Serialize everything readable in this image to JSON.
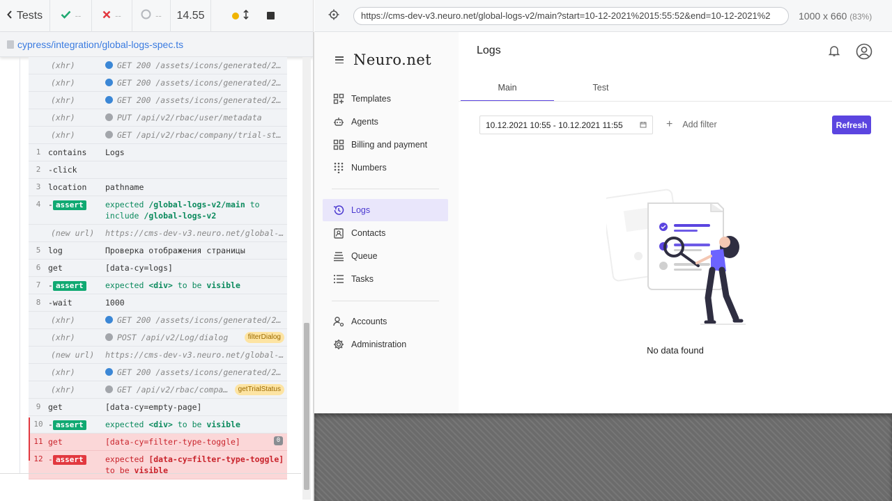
{
  "reporter": {
    "tests_label": "Tests",
    "passed": "--",
    "failed": "--",
    "pending": "--",
    "duration": "14.55",
    "spec_path": "cypress/integration/global-logs-spec.ts",
    "commands": [
      {
        "kind": "xhr",
        "num": "",
        "name": "(xhr)",
        "dot": "blue",
        "msg": "GET 200 /assets/icons/generated/24…",
        "tag": ""
      },
      {
        "kind": "xhr",
        "num": "",
        "name": "(xhr)",
        "dot": "blue",
        "msg": "GET 200 /assets/icons/generated/24…",
        "tag": ""
      },
      {
        "kind": "xhr",
        "num": "",
        "name": "(xhr)",
        "dot": "blue",
        "msg": "GET 200 /assets/icons/generated/24…",
        "tag": ""
      },
      {
        "kind": "xhr",
        "num": "",
        "name": "(xhr)",
        "dot": "grey",
        "msg": "PUT /api/v2/rbac/user/metadata",
        "tag": ""
      },
      {
        "kind": "xhr",
        "num": "",
        "name": "(xhr)",
        "dot": "grey",
        "msg": "GET /api/v2/rbac/company/trial-sta…",
        "tag": ""
      },
      {
        "kind": "cmd",
        "num": "1",
        "name": "contains",
        "msg": "Logs"
      },
      {
        "kind": "cmd",
        "num": "2",
        "name": "-click",
        "msg": ""
      },
      {
        "kind": "cmd",
        "num": "3",
        "name": "location",
        "msg": "pathname"
      },
      {
        "kind": "assert",
        "num": "4",
        "badge": "assert",
        "parts": [
          "expected ",
          "/global-logs-v2/main",
          " to include ",
          "/global-logs-v2"
        ]
      },
      {
        "kind": "xhr",
        "num": "",
        "name": "(new url)",
        "dot": "",
        "msg": "https://cms-dev-v3.neuro.net/global-l…",
        "tag": ""
      },
      {
        "kind": "cmd",
        "num": "5",
        "name": "log",
        "msg": "Проверка отображения страницы"
      },
      {
        "kind": "cmd",
        "num": "6",
        "name": "get",
        "msg": "[data-cy=logs]"
      },
      {
        "kind": "assert",
        "num": "7",
        "badge": "assert",
        "parts": [
          "expected ",
          "<div>",
          " to be ",
          "visible"
        ]
      },
      {
        "kind": "cmd",
        "num": "8",
        "name": "-wait",
        "msg": "1000"
      },
      {
        "kind": "xhr",
        "num": "",
        "name": "(xhr)",
        "dot": "blue",
        "msg": "GET 200 /assets/icons/generated/24…",
        "tag": ""
      },
      {
        "kind": "xhr",
        "num": "",
        "name": "(xhr)",
        "dot": "grey",
        "msg": "POST /api/v2/Log/dialog",
        "tag": "filterDialog"
      },
      {
        "kind": "xhr",
        "num": "",
        "name": "(new url)",
        "dot": "",
        "msg": "https://cms-dev-v3.neuro.net/global-logs-v2/…",
        "tag": ""
      },
      {
        "kind": "xhr",
        "num": "",
        "name": "(xhr)",
        "dot": "blue",
        "msg": "GET 200 /assets/icons/generated/24…",
        "tag": ""
      },
      {
        "kind": "xhr",
        "num": "",
        "name": "(xhr)",
        "dot": "grey",
        "msg": "GET /api/v2/rbac/compa…",
        "tag": "getTrialStatus"
      },
      {
        "kind": "cmd",
        "num": "9",
        "name": "get",
        "msg": "[data-cy=empty-page]"
      },
      {
        "kind": "assert",
        "num": "10",
        "badge": "assert",
        "parts": [
          "expected ",
          "<div>",
          " to be ",
          "visible"
        ]
      }
    ],
    "failed_cmd": {
      "num": "11",
      "name": "get",
      "msg": "[data-cy=filter-type-toggle]",
      "count": "0"
    },
    "failed_assert": {
      "num": "12",
      "badge": "assert",
      "line1a": "expected ",
      "line1b": "[data-cy=filter-type-toggle]",
      "line2a": "to be ",
      "line2b": "visible"
    }
  },
  "aut": {
    "url": "https://cms-dev-v3.neuro.net/global-logs-v2/main?start=10-12-2021%2015:55:52&end=10-12-2021%2",
    "viewport": "1000 x 660",
    "zoom": "(83%)"
  },
  "app": {
    "logo": "Neuro.net",
    "page_title": "Logs",
    "nav": [
      {
        "label": "Templates",
        "icon": "templates-icon"
      },
      {
        "label": "Agents",
        "icon": "robot-icon"
      },
      {
        "label": "Billing and payment",
        "icon": "billing-icon"
      },
      {
        "label": "Numbers",
        "icon": "dialpad-icon"
      },
      {
        "label": "Logs",
        "icon": "history-icon"
      },
      {
        "label": "Contacts",
        "icon": "contacts-icon"
      },
      {
        "label": "Queue",
        "icon": "queue-icon"
      },
      {
        "label": "Tasks",
        "icon": "tasks-icon"
      },
      {
        "label": "Accounts",
        "icon": "accounts-icon"
      },
      {
        "label": "Administration",
        "icon": "gear-icon"
      }
    ],
    "tabs": [
      "Main",
      "Test"
    ],
    "date_range": "10.12.2021 10:55 - 10.12.2021 11:55",
    "add_filter": "Add filter",
    "refresh": "Refresh",
    "empty_text": "No data found",
    "accent": "#5b45e0"
  }
}
